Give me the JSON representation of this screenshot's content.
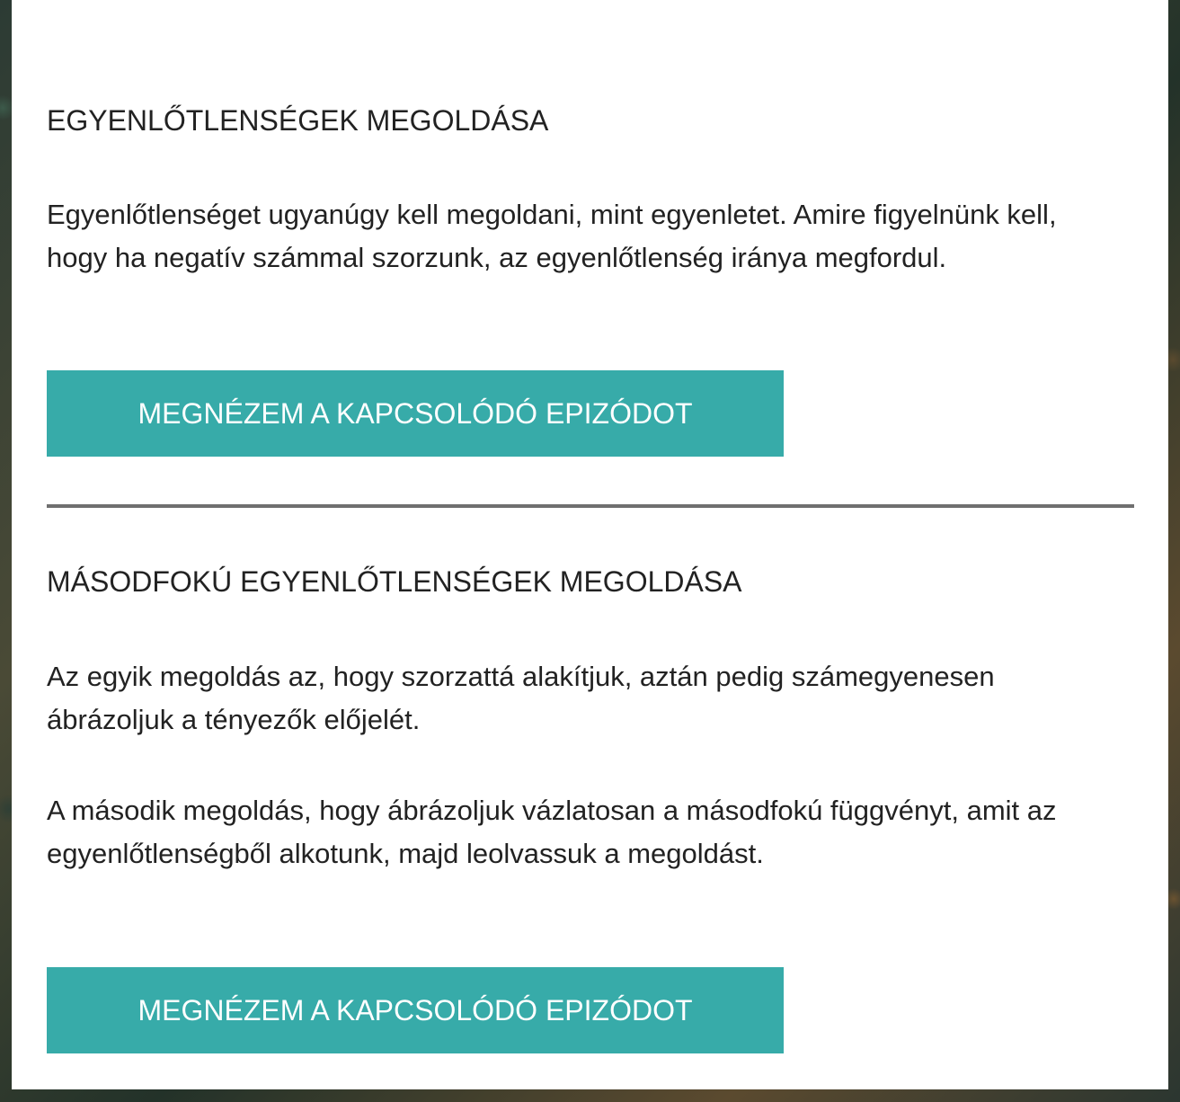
{
  "section1": {
    "title": "EGYENLŐTLENSÉGEK MEGOLDÁSA",
    "paragraph": "Egyenlőtlenséget ugyanúgy kell megoldani, mint egyenletet. Amire figyelnünk kell, hogy ha negatív számmal szorzunk, az egyenlőtlenség iránya megfordul.",
    "button_label": "MEGNÉZEM A KAPCSOLÓDÓ EPIZÓDOT"
  },
  "section2": {
    "title": "MÁSODFOKÚ EGYENLŐTLENSÉGEK MEGOLDÁSA",
    "paragraph1": "Az egyik megoldás az, hogy szorzattá alakítjuk, aztán pedig számegyenesen ábrázoljuk a tényezők előjelét.",
    "paragraph2": "A második megoldás, hogy ábrázoljuk vázlatosan a másodfokú függvényt, amit az egyenlőtlenségből alkotunk, majd leolvassuk a megoldást.",
    "button_label": "MEGNÉZEM A KAPCSOLÓDÓ EPIZÓDOT"
  },
  "colors": {
    "button": "#37aba9",
    "divider": "#6f6f6f",
    "text": "#222222",
    "panel": "#ffffff"
  }
}
